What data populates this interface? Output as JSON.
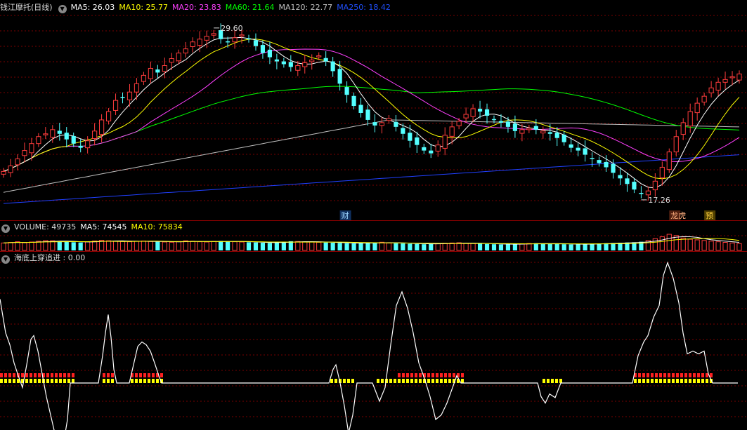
{
  "main_header": {
    "stock_name": "钱江摩托(日线)",
    "ma5": "MA5: 26.03",
    "ma10": "MA10: 25.77",
    "ma20": "MA20: 23.83",
    "ma60": "MA60: 21.64",
    "ma120": "MA120: 22.77",
    "ma250": "MA250: 18.42"
  },
  "volume_header": {
    "volume": "VOLUME: 49735",
    "ma5": "MA5: 74545",
    "ma10": "MA10: 75834"
  },
  "indicator_header": {
    "label": "海底上穿追进 : 0.00"
  },
  "annotations": {
    "high_label": "29.60",
    "low_label": "17.26",
    "marker_cai": "财",
    "marker_longhu": "龙虎",
    "marker_yu": "预"
  },
  "colors": {
    "up": "#ff3c3c",
    "down": "#54ffff",
    "ma5": "#ffffff",
    "ma10": "#ffff00",
    "ma20": "#ff40ff",
    "ma60": "#00ff00",
    "ma120": "#c0c0c0",
    "ma250": "#2040ff",
    "grid": "#7a0000"
  },
  "chart_data": [
    {
      "type": "candlestick",
      "title": "钱江摩托(日线)",
      "ylim": [
        16.5,
        30.5
      ],
      "high_annotation": 29.6,
      "low_annotation": 17.26,
      "closes": [
        19.3,
        19.7,
        20.2,
        20.8,
        21.3,
        21.8,
        22.0,
        22.3,
        22.0,
        21.6,
        21.3,
        21.0,
        21.5,
        22.2,
        23.0,
        23.6,
        24.4,
        24.6,
        25.0,
        25.6,
        26.2,
        26.7,
        26.4,
        26.9,
        27.4,
        27.8,
        28.1,
        28.6,
        28.8,
        29.0,
        29.2,
        28.8,
        28.6,
        28.9,
        29.1,
        28.8,
        28.3,
        27.8,
        27.5,
        27.2,
        27.0,
        26.8,
        26.9,
        27.1,
        27.3,
        27.6,
        27.2,
        26.5,
        25.6,
        24.8,
        24.0,
        23.5,
        23.0,
        22.6,
        22.8,
        23.1,
        22.5,
        22.0,
        21.5,
        21.2,
        20.8,
        20.6,
        21.2,
        21.9,
        22.5,
        22.9,
        23.4,
        23.8,
        23.6,
        23.3,
        23.0,
        22.8,
        22.5,
        22.2,
        22.3,
        22.4,
        22.3,
        22.2,
        22.0,
        21.7,
        21.4,
        21.0,
        20.8,
        20.5,
        20.2,
        19.9,
        19.6,
        19.2,
        18.8,
        18.4,
        18.0,
        17.7,
        17.9,
        18.6,
        19.6,
        20.7,
        21.8,
        22.8,
        23.6,
        24.2,
        24.7,
        25.3,
        25.7,
        25.9,
        26.1,
        26.3
      ],
      "ma_lines": [
        "MA5",
        "MA10",
        "MA20",
        "MA60",
        "MA120",
        "MA250"
      ]
    },
    {
      "type": "bar",
      "title": "VOLUME",
      "volume": 49735,
      "ma5": 74545,
      "ma10": 75834,
      "values": [
        60,
        65,
        70,
        62,
        68,
        74,
        80,
        78,
        72,
        70,
        66,
        64,
        70,
        76,
        82,
        78,
        75,
        72,
        70,
        74,
        76,
        72,
        70,
        68,
        66,
        72,
        78,
        74,
        70,
        68,
        72,
        76,
        74,
        70,
        68,
        66,
        64,
        62,
        60,
        66,
        70,
        74,
        72,
        70,
        68,
        66,
        64,
        62,
        60,
        58,
        56,
        60,
        62,
        64,
        66,
        60,
        58,
        56,
        54,
        52,
        50,
        54,
        56,
        58,
        60,
        62,
        58,
        56,
        54,
        52,
        50,
        48,
        50,
        52,
        54,
        56,
        58,
        56,
        54,
        52,
        50,
        48,
        50,
        52,
        54,
        56,
        58,
        60,
        62,
        64,
        66,
        70,
        80,
        95,
        110,
        130,
        120,
        100,
        90,
        85,
        80,
        75,
        70,
        65,
        60,
        55
      ]
    },
    {
      "type": "line",
      "title": "海底上穿追进",
      "value": 0.0,
      "points": [
        [
          0,
          0.92
        ],
        [
          8,
          0.55
        ],
        [
          14,
          0.42
        ],
        [
          20,
          0.22
        ],
        [
          26,
          0.08
        ],
        [
          32,
          -0.05
        ],
        [
          38,
          0.2
        ],
        [
          44,
          0.48
        ],
        [
          48,
          0.52
        ],
        [
          54,
          0.35
        ],
        [
          60,
          0.1
        ],
        [
          66,
          -0.15
        ],
        [
          72,
          -0.35
        ],
        [
          78,
          -0.55
        ],
        [
          84,
          -0.62
        ],
        [
          90,
          -0.68
        ],
        [
          96,
          -0.4
        ],
        [
          100,
          0.0
        ],
        [
          108,
          0.0
        ],
        [
          140,
          0.0
        ],
        [
          146,
          0.3
        ],
        [
          150,
          0.55
        ],
        [
          154,
          0.75
        ],
        [
          158,
          0.5
        ],
        [
          162,
          0.15
        ],
        [
          166,
          0.0
        ],
        [
          184,
          0.0
        ],
        [
          190,
          0.2
        ],
        [
          196,
          0.4
        ],
        [
          202,
          0.45
        ],
        [
          208,
          0.42
        ],
        [
          214,
          0.35
        ],
        [
          220,
          0.22
        ],
        [
          226,
          0.08
        ],
        [
          230,
          0.0
        ],
        [
          468,
          0.0
        ],
        [
          474,
          0.15
        ],
        [
          478,
          0.2
        ],
        [
          484,
          0.0
        ],
        [
          490,
          -0.25
        ],
        [
          496,
          -0.55
        ],
        [
          502,
          -0.35
        ],
        [
          508,
          0.0
        ],
        [
          530,
          0.0
        ],
        [
          540,
          -0.2
        ],
        [
          548,
          -0.05
        ],
        [
          556,
          0.42
        ],
        [
          564,
          0.85
        ],
        [
          572,
          1.0
        ],
        [
          580,
          0.82
        ],
        [
          588,
          0.55
        ],
        [
          596,
          0.22
        ],
        [
          604,
          0.05
        ],
        [
          612,
          -0.15
        ],
        [
          620,
          -0.4
        ],
        [
          628,
          -0.35
        ],
        [
          636,
          -0.22
        ],
        [
          644,
          -0.05
        ],
        [
          650,
          0.08
        ],
        [
          656,
          0.0
        ],
        [
          660,
          0.0
        ],
        [
          765,
          0.0
        ],
        [
          770,
          -0.15
        ],
        [
          776,
          -0.22
        ],
        [
          782,
          -0.12
        ],
        [
          790,
          -0.16
        ],
        [
          798,
          0.0
        ],
        [
          900,
          0.0
        ],
        [
          908,
          0.3
        ],
        [
          916,
          0.45
        ],
        [
          922,
          0.52
        ],
        [
          930,
          0.72
        ],
        [
          938,
          0.85
        ],
        [
          944,
          1.18
        ],
        [
          950,
          1.32
        ],
        [
          958,
          1.15
        ],
        [
          966,
          0.88
        ],
        [
          972,
          0.55
        ],
        [
          978,
          0.32
        ],
        [
          986,
          0.35
        ],
        [
          994,
          0.32
        ],
        [
          1002,
          0.35
        ],
        [
          1008,
          0.1
        ],
        [
          1014,
          0.0
        ],
        [
          1050,
          0.0
        ]
      ],
      "signal_bars": [
        {
          "from": 0,
          "to": 104,
          "red": true
        },
        {
          "from": 146,
          "to": 162,
          "red": true
        },
        {
          "from": 186,
          "to": 228,
          "red": true
        },
        {
          "from": 470,
          "to": 500,
          "red": false
        },
        {
          "from": 536,
          "to": 566,
          "red": false
        },
        {
          "from": 566,
          "to": 656,
          "red": true
        },
        {
          "from": 772,
          "to": 796,
          "red": false
        },
        {
          "from": 902,
          "to": 1012,
          "red": true
        }
      ]
    }
  ]
}
